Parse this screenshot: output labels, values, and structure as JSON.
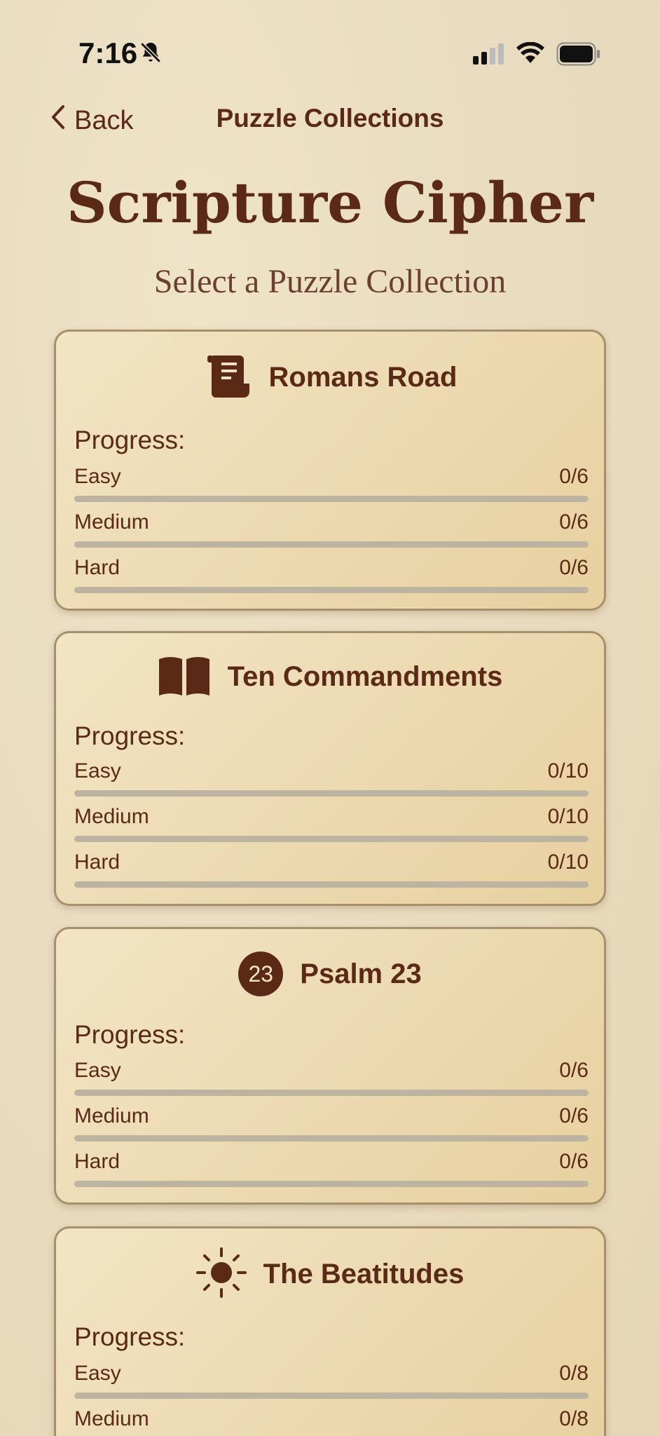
{
  "status": {
    "time": "7:16"
  },
  "nav": {
    "back_label": "Back",
    "title": "Puzzle Collections"
  },
  "header": {
    "title": "Scripture Cipher",
    "subtitle": "Select a Puzzle Collection"
  },
  "collections": [
    {
      "name": "Romans Road",
      "icon": "scroll-icon",
      "progress_label": "Progress:",
      "levels": [
        {
          "label": "Easy",
          "count": "0/6",
          "fraction": 0
        },
        {
          "label": "Medium",
          "count": "0/6",
          "fraction": 0
        },
        {
          "label": "Hard",
          "count": "0/6",
          "fraction": 0
        }
      ]
    },
    {
      "name": "Ten Commandments",
      "icon": "open-book-icon",
      "progress_label": "Progress:",
      "levels": [
        {
          "label": "Easy",
          "count": "0/10",
          "fraction": 0
        },
        {
          "label": "Medium",
          "count": "0/10",
          "fraction": 0
        },
        {
          "label": "Hard",
          "count": "0/10",
          "fraction": 0
        }
      ]
    },
    {
      "name": "Psalm 23",
      "icon": "number-23-icon",
      "badge": "23",
      "progress_label": "Progress:",
      "levels": [
        {
          "label": "Easy",
          "count": "0/6",
          "fraction": 0
        },
        {
          "label": "Medium",
          "count": "0/6",
          "fraction": 0
        },
        {
          "label": "Hard",
          "count": "0/6",
          "fraction": 0
        }
      ]
    },
    {
      "name": "The Beatitudes",
      "icon": "sun-icon",
      "progress_label": "Progress:",
      "levels": [
        {
          "label": "Easy",
          "count": "0/8",
          "fraction": 0
        },
        {
          "label": "Medium",
          "count": "0/8",
          "fraction": 0
        }
      ]
    }
  ],
  "colors": {
    "accent": "#5a2a16",
    "background": "#e9dcc0",
    "track": "#bdb3a1"
  }
}
